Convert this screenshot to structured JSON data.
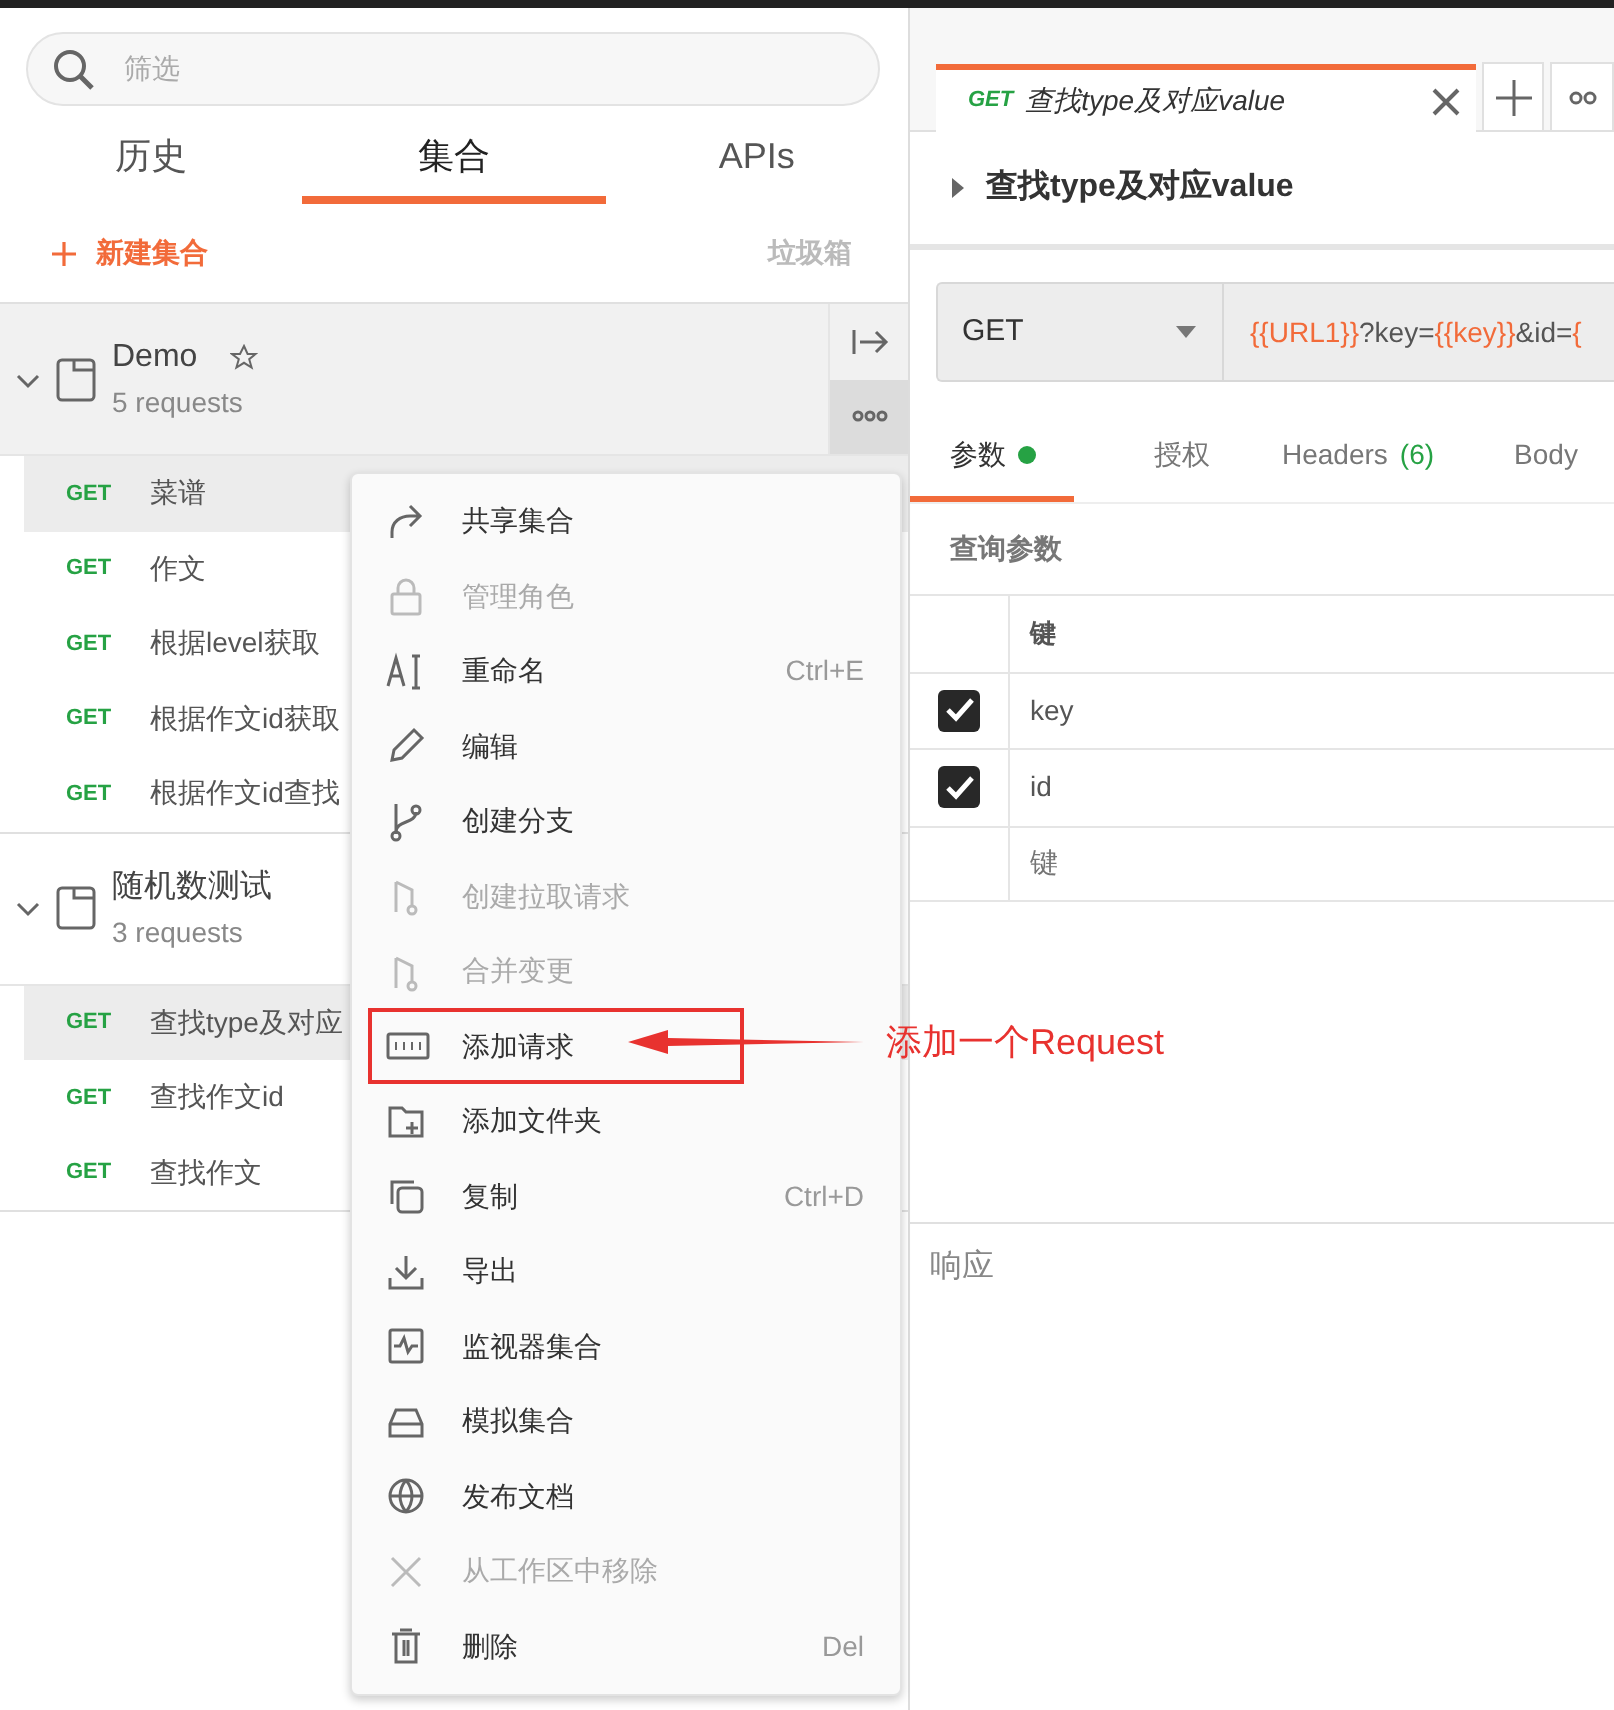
{
  "sidebar": {
    "search": {
      "placeholder": "筛选"
    },
    "tabs": [
      {
        "label": "历史",
        "selected": false
      },
      {
        "label": "集合",
        "selected": true
      },
      {
        "label": "APIs",
        "selected": false
      }
    ],
    "new_collection": "新建集合",
    "trash": "垃圾箱",
    "collections": [
      {
        "name": "Demo",
        "count": "5 requests",
        "expanded": true,
        "selected": true,
        "requests": [
          {
            "method": "GET",
            "name": "菜谱",
            "selected": true
          },
          {
            "method": "GET",
            "name": "作文",
            "selected": false
          },
          {
            "method": "GET",
            "name": "根据level获取",
            "selected": false
          },
          {
            "method": "GET",
            "name": "根据作文id获取",
            "selected": false
          },
          {
            "method": "GET",
            "name": "根据作文id查找",
            "selected": false
          }
        ]
      },
      {
        "name": "随机数测试",
        "count": "3 requests",
        "expanded": true,
        "selected": false,
        "requests": [
          {
            "method": "GET",
            "name": "查找type及对应",
            "selected": true
          },
          {
            "method": "GET",
            "name": "查找作文id",
            "selected": false
          },
          {
            "method": "GET",
            "name": "查找作文",
            "selected": false
          }
        ]
      }
    ]
  },
  "context_menu": {
    "items": [
      {
        "label": "共享集合",
        "disabled": false,
        "annotated": false
      },
      {
        "label": "管理角色",
        "disabled": true,
        "annotated": false
      },
      {
        "label": "重命名",
        "shortcut": "Ctrl+E",
        "disabled": false,
        "annotated": false
      },
      {
        "label": "编辑",
        "disabled": false,
        "annotated": false
      },
      {
        "label": "创建分支",
        "disabled": false,
        "annotated": false
      },
      {
        "label": "创建拉取请求",
        "disabled": true,
        "annotated": false
      },
      {
        "label": "合并变更",
        "disabled": true,
        "annotated": false
      },
      {
        "label": "添加请求",
        "disabled": false,
        "annotated": true
      },
      {
        "label": "添加文件夹",
        "disabled": false,
        "annotated": false
      },
      {
        "label": "复制",
        "shortcut": "Ctrl+D",
        "disabled": false,
        "annotated": false
      },
      {
        "label": "导出",
        "disabled": false,
        "annotated": false
      },
      {
        "label": "监视器集合",
        "disabled": false,
        "annotated": false
      },
      {
        "label": "模拟集合",
        "disabled": false,
        "annotated": false
      },
      {
        "label": "发布文档",
        "disabled": false,
        "annotated": false
      },
      {
        "label": "从工作区中移除",
        "disabled": true,
        "annotated": false
      },
      {
        "label": "删除",
        "shortcut": "Del",
        "disabled": false,
        "annotated": false
      }
    ]
  },
  "annotation": {
    "text": "添加一个Request"
  },
  "request_tab": {
    "method": "GET",
    "title": "查找type及对应value"
  },
  "request_title": "查找type及对应value",
  "method": "GET",
  "url": [
    {
      "text": "{{URL1}}",
      "variable": true
    },
    {
      "text": "?key=",
      "variable": false
    },
    {
      "text": "{{key}}",
      "variable": true
    },
    {
      "text": "&id=",
      "variable": false
    },
    {
      "text": "{",
      "variable": true
    }
  ],
  "param_tabs": [
    {
      "label": "参数",
      "selected": true,
      "dot": true
    },
    {
      "label": "授权",
      "selected": false,
      "dot": false
    },
    {
      "label": "Headers",
      "count": "(6)",
      "selected": false,
      "dot": false
    },
    {
      "label": "Body",
      "selected": false,
      "dot": false
    }
  ],
  "params": {
    "title": "查询参数",
    "column": "键",
    "rows": [
      {
        "key": "key",
        "checked": true
      },
      {
        "key": "id",
        "checked": true
      }
    ],
    "placeholder": "键"
  },
  "response": "响应"
}
